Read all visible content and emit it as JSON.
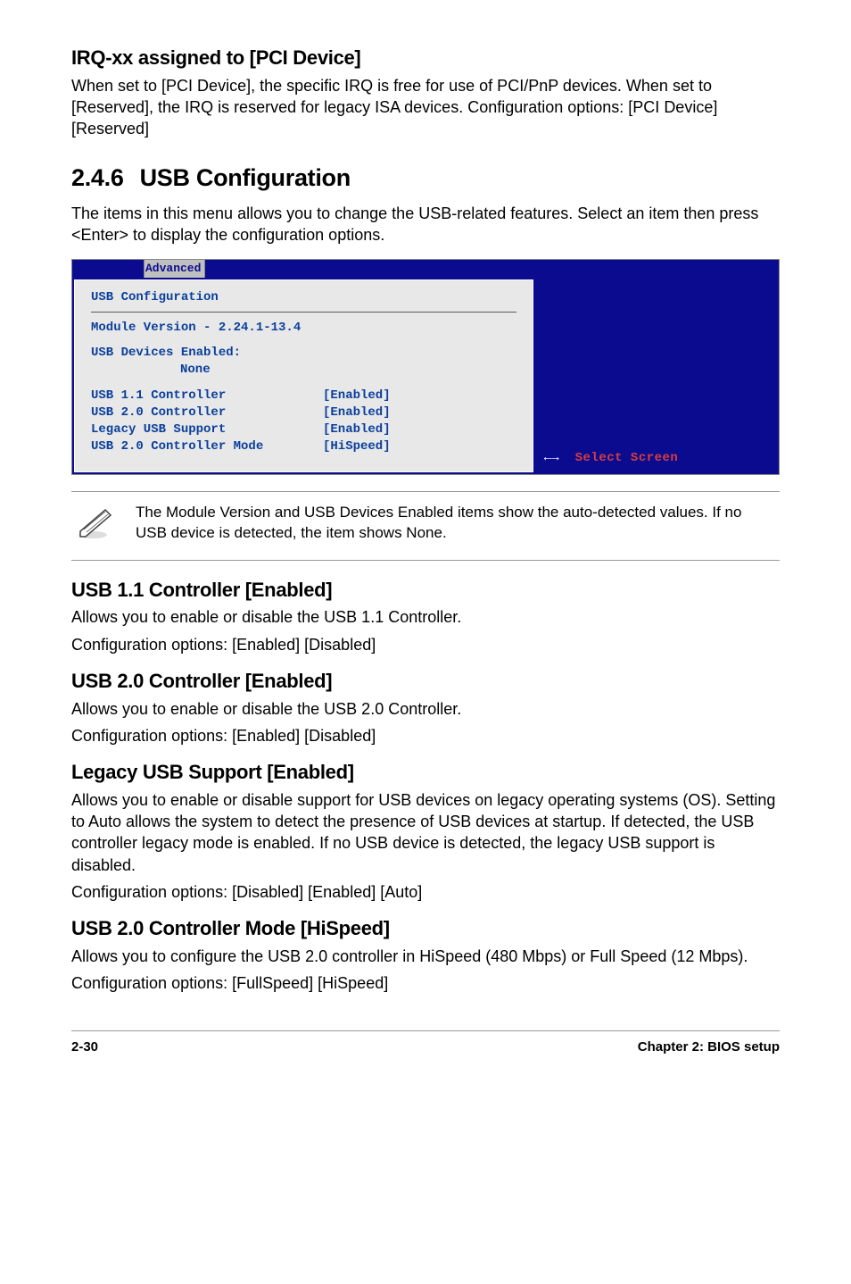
{
  "irq": {
    "heading": "IRQ-xx assigned to [PCI Device]",
    "body": "When set to [PCI Device], the specific IRQ is free for use of PCI/PnP devices. When set to [Reserved], the IRQ is reserved for legacy ISA devices. Configuration options: [PCI Device] [Reserved]"
  },
  "section": {
    "number": "2.4.6",
    "title": "USB Configuration",
    "intro": "The items in this menu allows you to change the USB-related features. Select an item then press <Enter> to display the configuration options."
  },
  "bios": {
    "tab": "Advanced",
    "title": "USB Configuration",
    "module": "Module Version - 2.24.1-13.4",
    "devices_label": "USB Devices Enabled:",
    "devices_value": "None",
    "items": [
      {
        "k": "USB 1.1 Controller",
        "v": "[Enabled]"
      },
      {
        "k": "USB 2.0 Controller",
        "v": "[Enabled]"
      },
      {
        "k": "Legacy USB Support",
        "v": "[Enabled]"
      },
      {
        "k": "USB 2.0 Controller Mode",
        "v": "[HiSpeed]"
      }
    ],
    "side": {
      "arrows": "←→",
      "label": "Select Screen"
    }
  },
  "note": {
    "text": "The Module Version and USB Devices Enabled items show the auto-detected values. If no USB device is detected, the item shows None."
  },
  "usb11": {
    "heading": "USB 1.1 Controller [Enabled]",
    "l1": "Allows you to enable or disable the USB 1.1 Controller.",
    "l2": "Configuration options: [Enabled] [Disabled]"
  },
  "usb20": {
    "heading": "USB 2.0 Controller [Enabled]",
    "l1": "Allows you to enable or disable the USB 2.0 Controller.",
    "l2": "Configuration options: [Enabled] [Disabled]"
  },
  "legacy": {
    "heading": "Legacy USB Support [Enabled]",
    "l1": "Allows you to enable or disable support for USB devices on legacy operating systems (OS). Setting to Auto allows the system to detect the presence of USB devices at startup. If detected, the USB controller legacy mode is enabled. If no USB device is detected, the legacy USB support is disabled.",
    "l2": "Configuration options: [Disabled] [Enabled] [Auto]"
  },
  "usb20mode": {
    "heading": "USB 2.0 Controller Mode [HiSpeed]",
    "l1": "Allows you to configure the USB 2.0 controller in HiSpeed (480 Mbps) or Full Speed (12 Mbps).",
    "l2": "Configuration options: [FullSpeed] [HiSpeed]"
  },
  "footer": {
    "left": "2-30",
    "right": "Chapter 2: BIOS setup"
  }
}
